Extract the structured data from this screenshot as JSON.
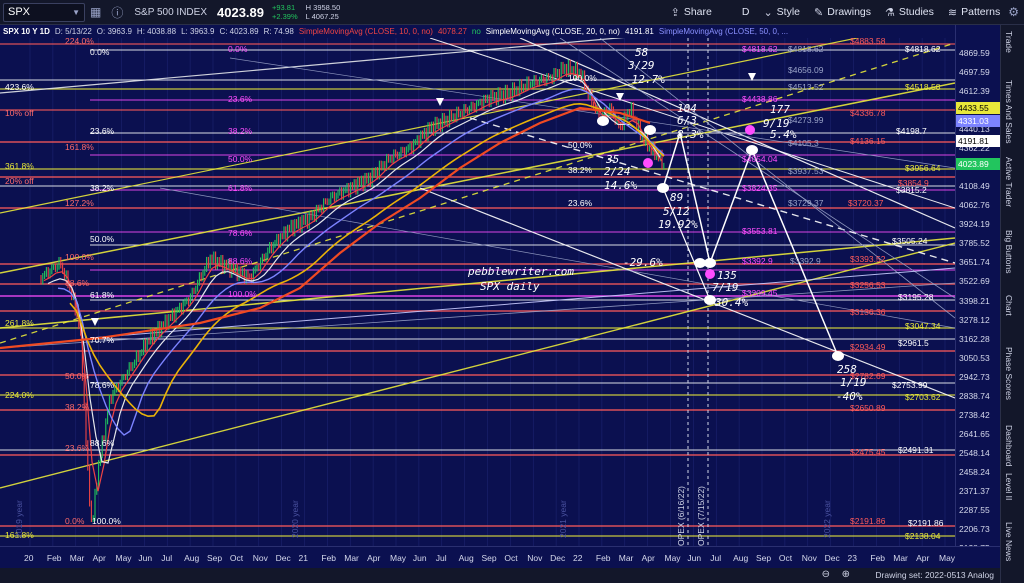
{
  "toolbar": {
    "symbol": "SPX",
    "index_name": "S&P 500 INDEX",
    "last_price": "4023.89",
    "change": "+93.81",
    "change_pct": "+2.39%",
    "high": "H 3958.50",
    "low": "L 4067.25",
    "share": "Share",
    "draw_period": "D",
    "style": "Style",
    "drawings": "Drawings",
    "studies": "Studies",
    "patterns": "Patterns"
  },
  "infobar": {
    "title": "SPX 10 Y 1D",
    "date": "D: 5/13/22",
    "open": "O: 3963.9",
    "high": "H: 4038.88",
    "low": "L: 3963.9",
    "close": "C: 4023.89",
    "range": "R: 74.98",
    "sma10": "SimpleMovingAvg (CLOSE, 10, 0, no)",
    "sma10_val": "4078.27",
    "sma10_flags": "no",
    "sma20": "SimpleMovingAvg (CLOSE, 20, 0, no)",
    "sma20_val": "4191.81",
    "sma50": "SimpleMovingAvg (CLOSE, 50, 0, ..."
  },
  "colors": {
    "bg": "#0b1050",
    "candle_up": "#22c55e",
    "candle_down": "#ef4444",
    "sma10": "#ef4444",
    "sma20": "#e5e7eb",
    "sma50": "#7c83ff",
    "sma100": "#eab308",
    "sma200": "#f04a22",
    "fib_magenta": "#ff4dff",
    "fib_yellow": "#e8e83a",
    "fib_red": "#ff5a5a"
  },
  "y_labels": [
    "4869.59",
    "4697.59",
    "4612.39",
    "4527.91",
    "4440.13",
    "4362.22",
    "4244.31",
    "4108.49",
    "4062.76",
    "3924.19",
    "3785.52",
    "3651.74",
    "3522.69",
    "3398.21",
    "3278.12",
    "3162.28",
    "3050.53",
    "2942.73",
    "2838.74",
    "2738.42",
    "2641.65",
    "2548.14",
    "2458.24",
    "2371.37",
    "2287.55",
    "2206.73",
    "2128.75"
  ],
  "y_badges": [
    {
      "text": "4433.55",
      "color": "#e8e83a",
      "dark": true
    },
    {
      "text": "4331.03",
      "color": "#7c83ff",
      "dark": false
    },
    {
      "text": "4191.81",
      "color": "#ffffff",
      "dark": true
    },
    {
      "text": "4023.89",
      "color": "#22c55e",
      "dark": false
    }
  ],
  "x_labels": [
    "20",
    "Feb",
    "Mar",
    "Apr",
    "May",
    "Jun",
    "Jul",
    "Aug",
    "Sep",
    "Oct",
    "Nov",
    "Dec",
    "21",
    "Feb",
    "Mar",
    "Apr",
    "May",
    "Jun",
    "Jul",
    "Aug",
    "Sep",
    "Oct",
    "Nov",
    "Dec",
    "22",
    "Feb",
    "Mar",
    "Apr",
    "May",
    "Jun",
    "Jul",
    "Aug",
    "Sep",
    "Oct",
    "Nov",
    "Dec",
    "23",
    "Feb",
    "Mar",
    "Apr",
    "May"
  ],
  "left_fib": [
    {
      "text": "224.0%",
      "color": "#ff6b6b"
    },
    {
      "text": "0.0%",
      "color": "#ffffff"
    },
    {
      "text": "423.6%",
      "color": "#ffffff"
    },
    {
      "text": "10% off",
      "color": "#ff6b6b"
    },
    {
      "text": "23.6%",
      "color": "#ffffff"
    },
    {
      "text": "161.8%",
      "color": "#ff6b6b"
    },
    {
      "text": "361.8%",
      "color": "#e8e83a"
    },
    {
      "text": "20% off",
      "color": "#ff6b6b"
    },
    {
      "text": "38.2%",
      "color": "#ffffff"
    },
    {
      "text": "127.2%",
      "color": "#ff6b6b"
    },
    {
      "text": "50.0%",
      "color": "#ffffff"
    },
    {
      "text": "100.0%",
      "color": "#ff6b6b"
    },
    {
      "text": "88.6%",
      "color": "#ff6b6b"
    },
    {
      "text": "61.8%",
      "color": "#ffffff"
    },
    {
      "text": "261.8%",
      "color": "#e8e83a"
    },
    {
      "text": "70.7%",
      "color": "#ffffff"
    },
    {
      "text": "50.0%",
      "color": "#ff6b6b"
    },
    {
      "text": "78.6%",
      "color": "#ffffff"
    },
    {
      "text": "224.0%",
      "color": "#e8e83a"
    },
    {
      "text": "38.2%",
      "color": "#ff6b6b"
    },
    {
      "text": "88.6%",
      "color": "#ffffff"
    },
    {
      "text": "23.6%",
      "color": "#ff6b6b"
    },
    {
      "text": "0.0%",
      "color": "#ff6b6b"
    },
    {
      "text": "100.0%",
      "color": "#ffffff"
    },
    {
      "text": "161.8%",
      "color": "#e8e83a"
    }
  ],
  "mid_fib": [
    {
      "text": "0.0%",
      "color": "#ff4dff"
    },
    {
      "text": "23.6%",
      "color": "#ff4dff"
    },
    {
      "text": "38.2%",
      "color": "#ff4dff"
    },
    {
      "text": "50.0%",
      "color": "#ff4dff"
    },
    {
      "text": "61.8%",
      "color": "#ff4dff"
    },
    {
      "text": "78.6%",
      "color": "#ff4dff"
    },
    {
      "text": "88.6%",
      "color": "#ff4dff"
    },
    {
      "text": "100.0%",
      "color": "#ff4dff"
    },
    {
      "text": "100.0%",
      "color": "#ffffff"
    },
    {
      "text": "50.0%",
      "color": "#ffffff"
    },
    {
      "text": "38.2%",
      "color": "#ffffff"
    },
    {
      "text": "23.6%",
      "color": "#ffffff"
    }
  ],
  "price_tags": [
    {
      "text": "$4883.58",
      "color": "#ff5a5a"
    },
    {
      "text": "$4818.62",
      "color": "#ff4dff"
    },
    {
      "text": "$4818.62",
      "color": "#9aa3c8"
    },
    {
      "text": "$4818.62",
      "color": "#ffffff"
    },
    {
      "text": "$4656.09",
      "color": "#9aa3c8"
    },
    {
      "text": "$4518.58",
      "color": "#e8e83a"
    },
    {
      "text": "$4513.52",
      "color": "#9aa3c8"
    },
    {
      "text": "$4438.86",
      "color": "#ff4dff"
    },
    {
      "text": "$4336.78",
      "color": "#ff5a5a"
    },
    {
      "text": "$4273.99",
      "color": "#9aa3c8"
    },
    {
      "text": "$4198.7",
      "color": "#ffffff"
    },
    {
      "text": "$4136.15",
      "color": "#ff5a5a"
    },
    {
      "text": "$4105.3",
      "color": "#9aa3c8"
    },
    {
      "text": "$4054.04",
      "color": "#ff4dff"
    },
    {
      "text": "$3956.64",
      "color": "#e8e83a"
    },
    {
      "text": "$3937.53",
      "color": "#9aa3c8"
    },
    {
      "text": "$3854.9",
      "color": "#ff5a5a"
    },
    {
      "text": "$3824.35",
      "color": "#ff4dff"
    },
    {
      "text": "$3815.2",
      "color": "#ffffff"
    },
    {
      "text": "$3729.37",
      "color": "#9aa3c8"
    },
    {
      "text": "$3720.37",
      "color": "#ff5a5a"
    },
    {
      "text": "$3553.81",
      "color": "#ff4dff"
    },
    {
      "text": "$3505.24",
      "color": "#ffffff"
    },
    {
      "text": "$3393.52",
      "color": "#ff5a5a"
    },
    {
      "text": "$3392.9",
      "color": "#ff4dff"
    },
    {
      "text": "$3392.9",
      "color": "#9aa3c8"
    },
    {
      "text": "$3256.53",
      "color": "#ff5a5a"
    },
    {
      "text": "$3209.45",
      "color": "#ff4dff"
    },
    {
      "text": "$3195.28",
      "color": "#ffffff"
    },
    {
      "text": "$3136.36",
      "color": "#ff5a5a"
    },
    {
      "text": "$3047.34",
      "color": "#e8e83a"
    },
    {
      "text": "$2961.5",
      "color": "#ffffff"
    },
    {
      "text": "$2934.49",
      "color": "#ff5a5a"
    },
    {
      "text": "$2782.69",
      "color": "#ff5a5a"
    },
    {
      "text": "$2753.99",
      "color": "#ffffff"
    },
    {
      "text": "$2703.62",
      "color": "#e8e83a"
    },
    {
      "text": "$2650.89",
      "color": "#ff5a5a"
    },
    {
      "text": "$2491.31",
      "color": "#ffffff"
    },
    {
      "text": "$2475.45",
      "color": "#ff5a5a"
    },
    {
      "text": "$2191.86",
      "color": "#ff5a5a"
    },
    {
      "text": "$2191.86",
      "color": "#ffffff"
    },
    {
      "text": "$2138.04",
      "color": "#e8e83a"
    }
  ],
  "annotations": [
    {
      "text": "58"
    },
    {
      "text": "3/29"
    },
    {
      "text": "-12.7%"
    },
    {
      "text": "104"
    },
    {
      "text": "6/3"
    },
    {
      "text": "8.3%"
    },
    {
      "text": "177"
    },
    {
      "text": "9/19"
    },
    {
      "text": "5.4%"
    },
    {
      "text": "35"
    },
    {
      "text": "2/24"
    },
    {
      "text": "14.6%"
    },
    {
      "text": "89"
    },
    {
      "text": "5/12"
    },
    {
      "text": "19.92%"
    },
    {
      "text": "-29.6%"
    },
    {
      "text": "135"
    },
    {
      "text": "7/19"
    },
    {
      "text": "30.4%"
    },
    {
      "text": "258"
    },
    {
      "text": "1/19"
    },
    {
      "text": "-40%"
    }
  ],
  "watermark": {
    "line1": "pebblewriter.com",
    "line2": "SPX daily"
  },
  "vertical_markers": [
    {
      "text": "OPEX (6/16/22)"
    },
    {
      "text": "OPEX (7/15/22)"
    }
  ],
  "year_markers": [
    "2019 year",
    "2020 year",
    "2021 year",
    "2022 year"
  ],
  "right_tabs": [
    "Trade",
    "Times And Sales",
    "Active Trader",
    "Big Buttons",
    "Chart",
    "Phase Scores",
    "Dashboard",
    "Level II",
    "Live News"
  ],
  "bottom": {
    "drawing_set": "Drawing set: 2022-0513 Analog"
  }
}
